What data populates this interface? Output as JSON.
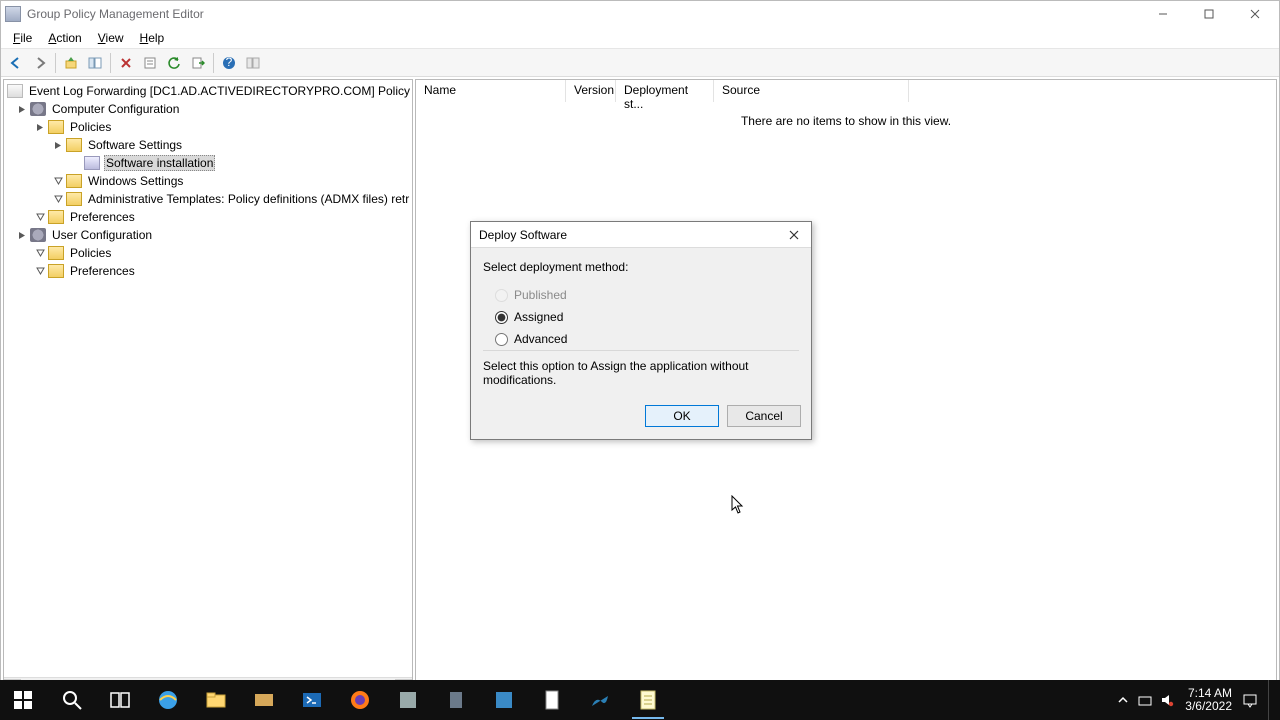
{
  "titlebar": {
    "title": "Group Policy Management Editor"
  },
  "menubar": [
    "File",
    "Action",
    "View",
    "Help"
  ],
  "tree": {
    "root": "Event Log Forwarding [DC1.AD.ACTIVEDIRECTORYPRO.COM] Policy",
    "computer_cfg": "Computer Configuration",
    "policies": "Policies",
    "software_settings": "Software Settings",
    "software_installation": "Software installation",
    "windows_settings": "Windows Settings",
    "admx": "Administrative Templates: Policy definitions (ADMX files) retr",
    "preferences": "Preferences",
    "user_cfg": "User Configuration",
    "user_policies": "Policies",
    "user_preferences": "Preferences"
  },
  "list": {
    "columns": {
      "name": "Name",
      "version": "Version",
      "deploy": "Deployment st...",
      "source": "Source"
    },
    "empty": "There are no items to show in this view."
  },
  "dialog": {
    "title": "Deploy Software",
    "prompt": "Select deployment method:",
    "options": {
      "published": "Published",
      "assigned": "Assigned",
      "advanced": "Advanced"
    },
    "description": "Select this option to Assign the application without modifications.",
    "ok": "OK",
    "cancel": "Cancel"
  },
  "tray": {
    "time": "7:14 AM",
    "date": "3/6/2022"
  }
}
